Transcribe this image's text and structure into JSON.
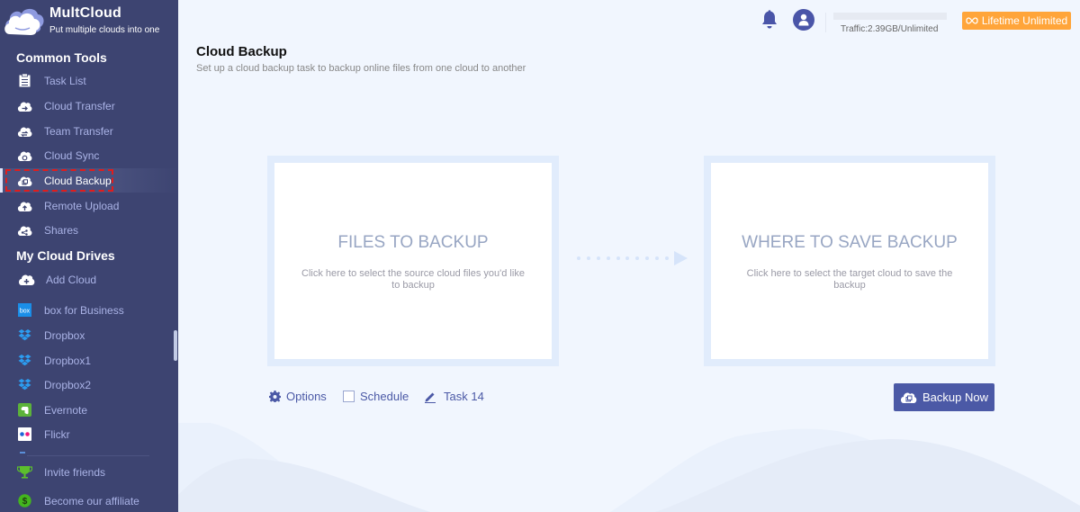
{
  "app": {
    "name": "MultCloud",
    "tagline": "Put multiple clouds into one"
  },
  "sidebar": {
    "common_tools_title": "Common Tools",
    "common_tools": [
      {
        "label": "Task List",
        "icon": "clipboard-icon"
      },
      {
        "label": "Cloud Transfer",
        "icon": "cloud-transfer-icon"
      },
      {
        "label": "Team Transfer",
        "icon": "team-transfer-icon"
      },
      {
        "label": "Cloud Sync",
        "icon": "cloud-sync-icon"
      },
      {
        "label": "Cloud Backup",
        "icon": "cloud-backup-icon",
        "active": true
      },
      {
        "label": "Remote Upload",
        "icon": "cloud-upload-icon"
      },
      {
        "label": "Shares",
        "icon": "share-icon"
      }
    ],
    "drives_title": "My Cloud Drives",
    "drives": [
      {
        "label": "Add Cloud",
        "icon": "add-cloud-icon"
      },
      {
        "label": "box for Business",
        "icon": "box-icon"
      },
      {
        "label": "Dropbox",
        "icon": "dropbox-icon"
      },
      {
        "label": "Dropbox1",
        "icon": "dropbox-icon"
      },
      {
        "label": "Dropbox2",
        "icon": "dropbox-icon"
      },
      {
        "label": "Evernote",
        "icon": "evernote-icon"
      },
      {
        "label": "Flickr",
        "icon": "flickr-icon"
      }
    ],
    "footer": [
      {
        "label": "Invite friends",
        "icon": "trophy-icon"
      },
      {
        "label": "Become our affiliate",
        "icon": "dollar-icon"
      }
    ]
  },
  "header": {
    "traffic": "Traffic:2.39GB/Unlimited",
    "plan_label": "Lifetime Unlimited",
    "plan_color": "#ffa53a"
  },
  "page": {
    "title": "Cloud Backup",
    "subtitle": "Set up a cloud backup task to backup online files from one cloud to another"
  },
  "source_card": {
    "title": "FILES TO BACKUP",
    "description": "Click here to select the source cloud files you'd like to backup"
  },
  "target_card": {
    "title": "WHERE TO SAVE BACKUP",
    "description": "Click here to select the target cloud to save the backup"
  },
  "toolbar": {
    "options_label": "Options",
    "schedule_label": "Schedule",
    "schedule_checked": false,
    "task_name": "Task 14",
    "backup_now_label": "Backup Now"
  },
  "colors": {
    "sidebar_bg": "#3d4471",
    "accent": "#4b59a6",
    "highlight_outline": "#e01d1d"
  }
}
